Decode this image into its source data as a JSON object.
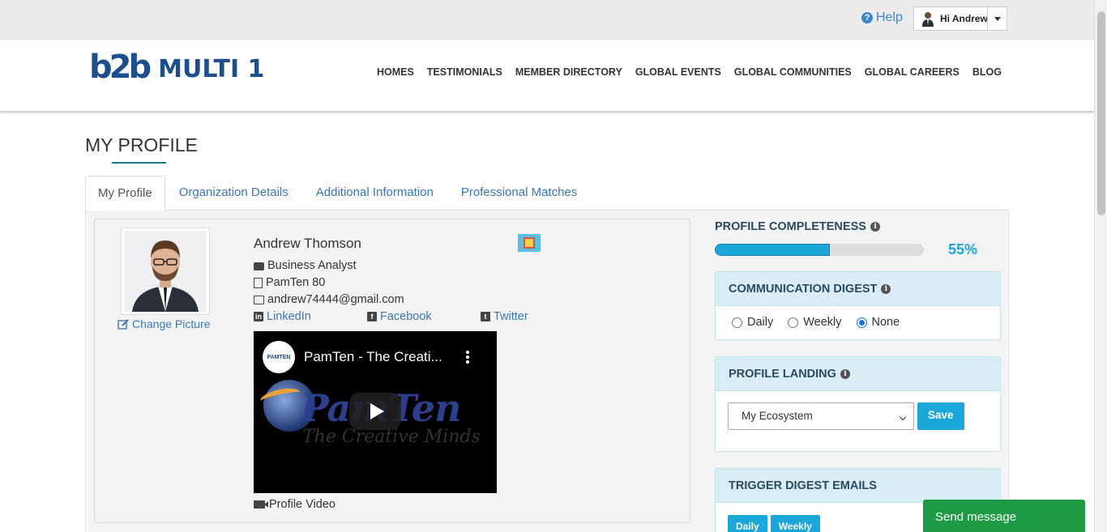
{
  "topbar": {
    "help_label": "Help",
    "user_greeting": "Hi Andrew"
  },
  "header": {
    "logo_b2b_first": "b",
    "logo_b2b_mid": "2",
    "logo_b2b_last": "b",
    "logo_text": "MULTI 1",
    "nav": [
      "HOMES",
      "TESTIMONIALS",
      "MEMBER DIRECTORY",
      "GLOBAL EVENTS",
      "GLOBAL COMMUNITIES",
      "GLOBAL CAREERS",
      "BLOG"
    ]
  },
  "page": {
    "title": "MY PROFILE",
    "tabs": [
      "My Profile",
      "Organization Details",
      "Additional Information",
      "Professional Matches"
    ],
    "active_tab": "My Profile"
  },
  "profile": {
    "change_picture": "Change Picture",
    "name": "Andrew Thomson",
    "job_title": "Business Analyst",
    "company": "PamTen 80",
    "email": "andrew74444@gmail.com",
    "social": {
      "linkedin": "LinkedIn",
      "facebook": "Facebook",
      "twitter": "Twitter"
    },
    "video": {
      "channel_logo": "PAMTEN",
      "title": "PamTen - The Creati...",
      "brand": "PamTen",
      "tagline": "The Creative Minds"
    },
    "video_label": "Profile Video"
  },
  "completeness": {
    "label": "PROFILE COMPLETENESS",
    "percent_text": "55%",
    "percent_value": 55
  },
  "communication_digest": {
    "label": "COMMUNICATION DIGEST",
    "options": [
      "Daily",
      "Weekly",
      "None"
    ],
    "selected": "None"
  },
  "profile_landing": {
    "label": "PROFILE LANDING",
    "selected": "My Ecosystem",
    "save_label": "Save"
  },
  "trigger_digest": {
    "label": "TRIGGER DIGEST EMAILS",
    "buttons": [
      "Daily",
      "Weekly"
    ]
  },
  "chat": {
    "send_message": "Send message"
  },
  "colors": {
    "accent": "#1ba7d8",
    "link": "#3a77b8",
    "brand_teal": "#1a8a9a",
    "brand_navy": "#1d4e8e",
    "chat_green": "#1e9a45"
  },
  "icons": [
    "question-circle-icon",
    "user-avatar-icon",
    "caret-down-icon",
    "edit-icon",
    "briefcase-icon",
    "building-icon",
    "envelope-icon",
    "linkedin-icon",
    "facebook-icon",
    "twitter-icon",
    "video-camera-icon",
    "info-icon",
    "play-icon",
    "more-vertical-icon"
  ]
}
